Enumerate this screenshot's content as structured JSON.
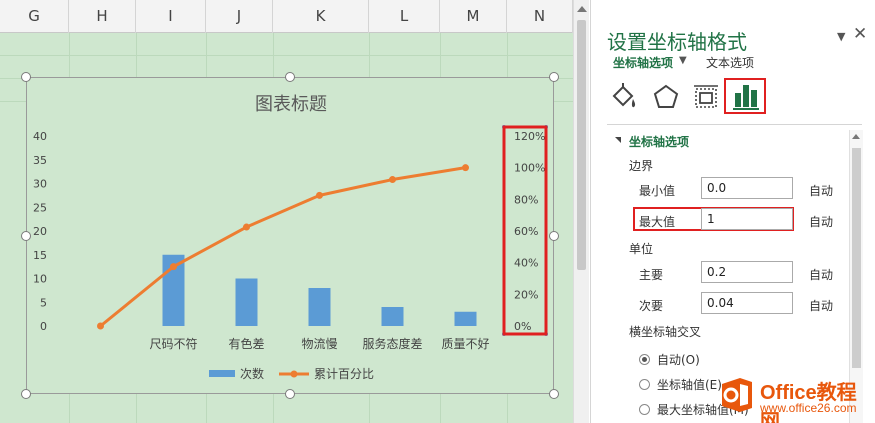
{
  "sheet": {
    "columns": [
      "G",
      "H",
      "I",
      "J",
      "K",
      "L",
      "M",
      "N"
    ]
  },
  "chart_data": {
    "type": "bar",
    "title": "图表标题",
    "categories": [
      "",
      "尺码不符",
      "有色差",
      "物流慢",
      "服务态度差",
      "质量不好"
    ],
    "series": [
      {
        "name": "次数",
        "type": "bar",
        "axis": "primary",
        "values": [
          null,
          15,
          10,
          8,
          4,
          3
        ],
        "color": "#5b9bd5"
      },
      {
        "name": "累计百分比",
        "type": "line",
        "axis": "secondary",
        "values": [
          0,
          0.375,
          0.625,
          0.825,
          0.925,
          1.0
        ],
        "color": "#ed7d31"
      }
    ],
    "y_primary": {
      "min": 0,
      "max": 40,
      "step": 5,
      "ticks": [
        "0",
        "5",
        "10",
        "15",
        "20",
        "25",
        "30",
        "35",
        "40"
      ]
    },
    "y_secondary": {
      "min": 0,
      "max": 1.2,
      "step": 0.2,
      "ticks": [
        "0%",
        "20%",
        "40%",
        "60%",
        "80%",
        "100%",
        "120%"
      ]
    },
    "grid": false,
    "legend": "bottom",
    "highlight": "secondary-axis"
  },
  "pane": {
    "title": "设置坐标轴格式",
    "tab_axis_options": "坐标轴选项",
    "tab_text_options": "文本选项",
    "section_title": "坐标轴选项",
    "bounds_label": "边界",
    "min_label": "最小值",
    "min_value": "0.0",
    "max_label": "最大值",
    "max_value": "1",
    "units_label": "单位",
    "major_label": "主要",
    "major_value": "0.2",
    "minor_label": "次要",
    "minor_value": "0.04",
    "auto_label": "自动",
    "cross_label": "横坐标轴交叉",
    "radio_auto": "自动(O)",
    "radio_axis_value": "坐标轴值(E)",
    "radio_max_axis_value": "最大坐标轴值(M)"
  },
  "watermark": {
    "brand": "Office教程网",
    "url": "www.office26.com"
  },
  "colors": {
    "accent": "#217346",
    "highlight": "#e02020",
    "bar": "#5b9bd5",
    "line": "#ed7d31",
    "sheet_bg": "#cfe7cf"
  }
}
